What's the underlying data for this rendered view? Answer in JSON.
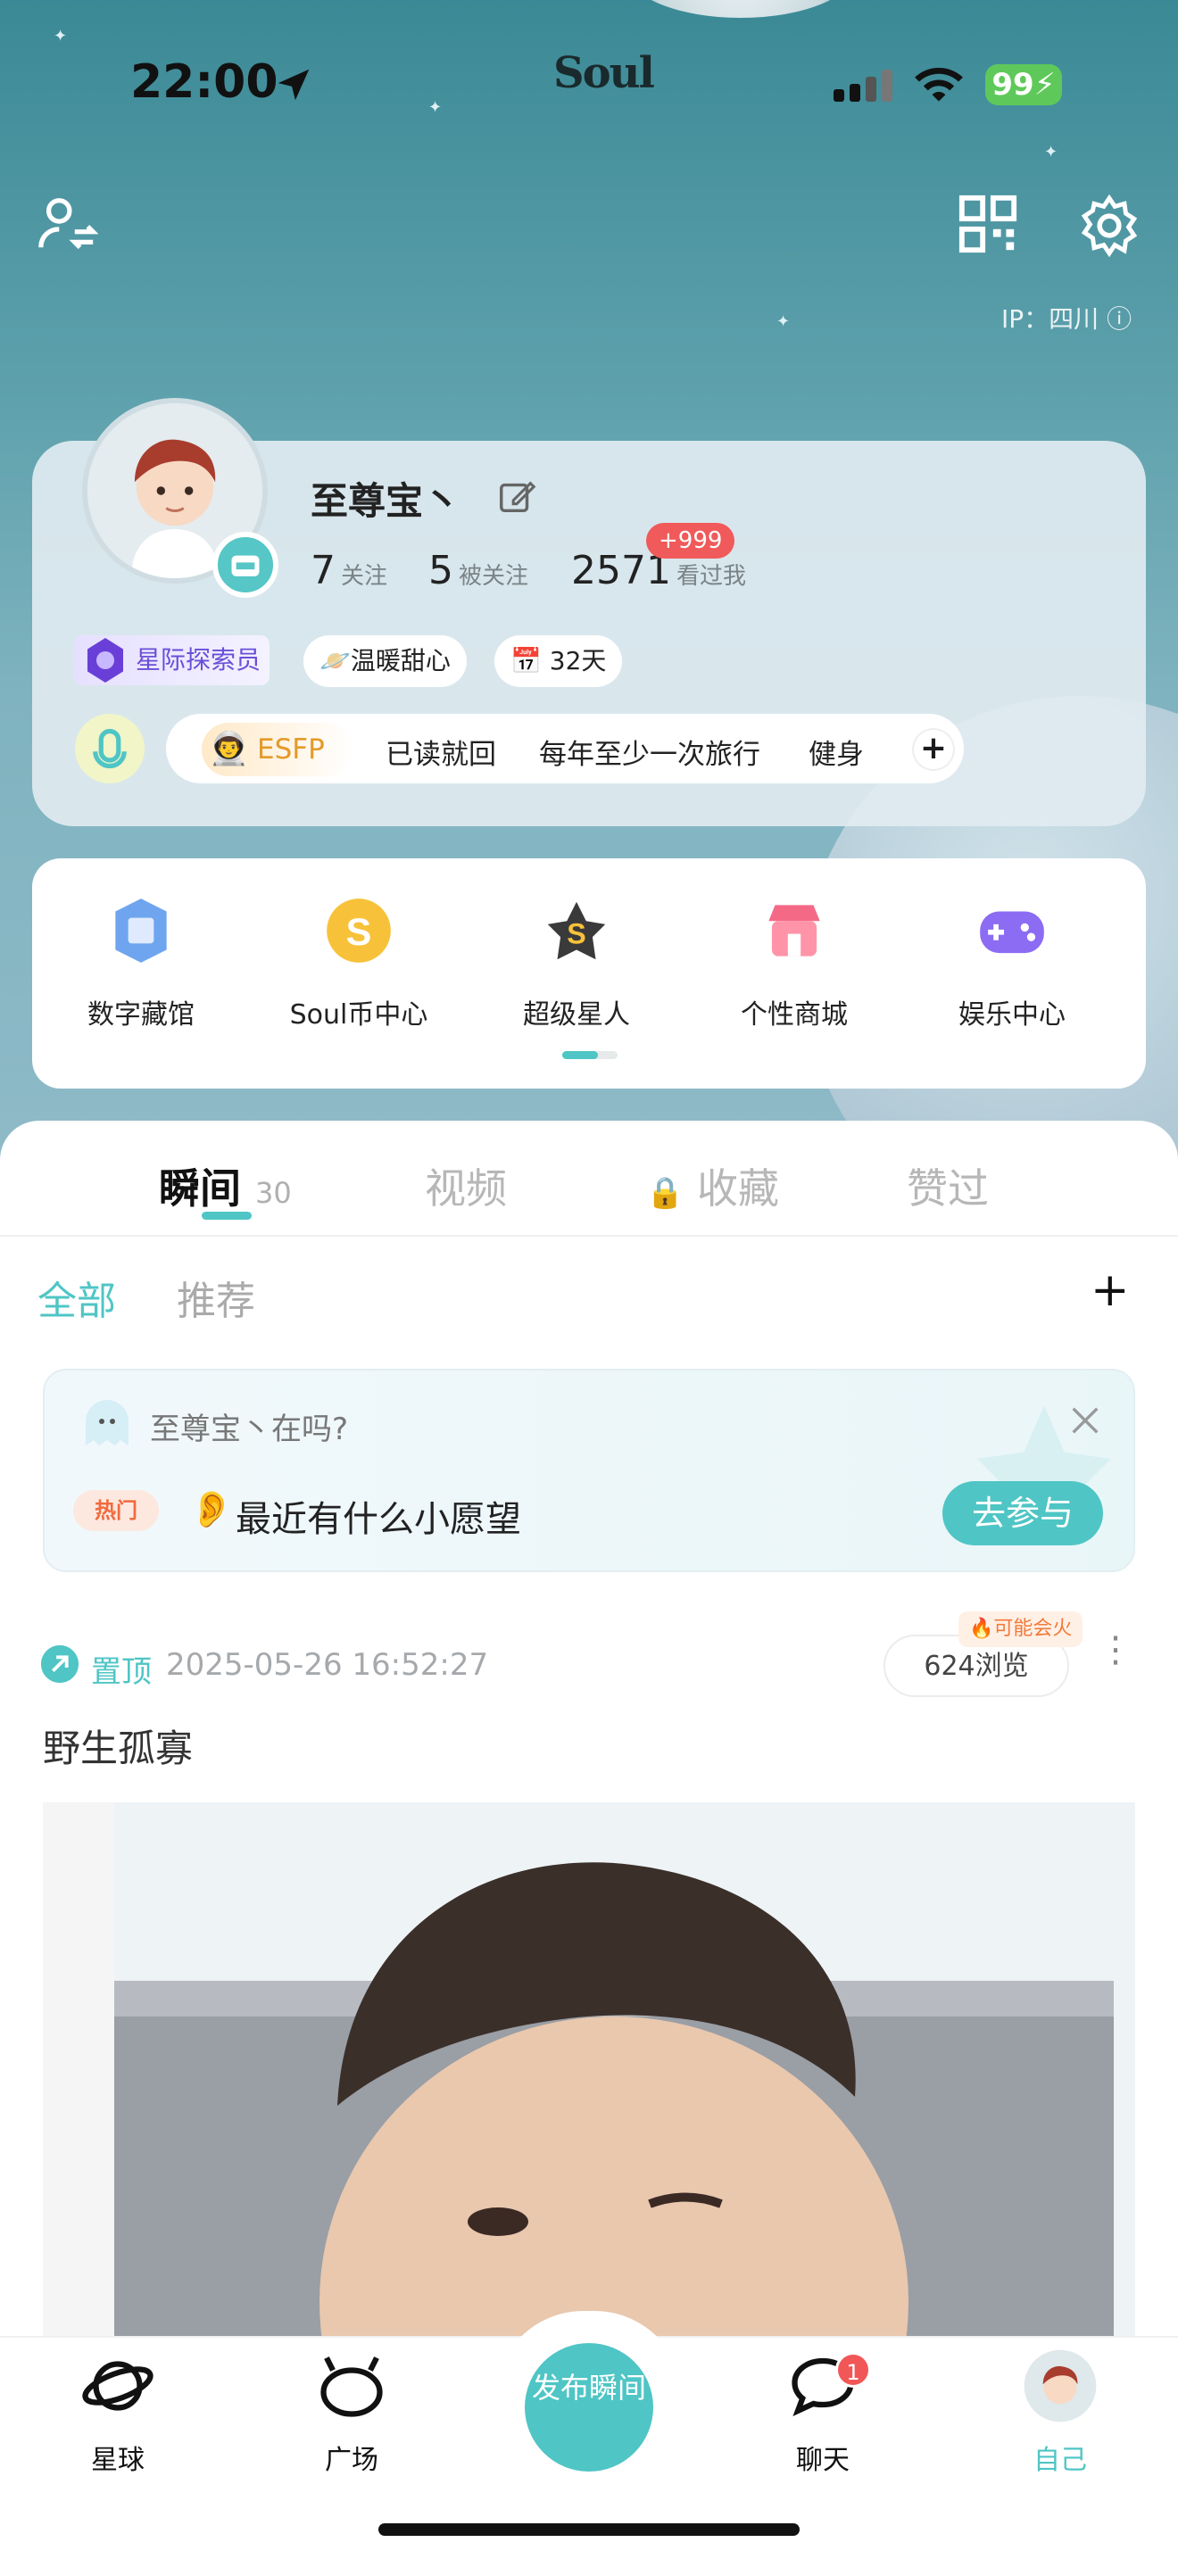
{
  "status_bar": {
    "time": "22:00",
    "app_brand": "Soul",
    "battery": "99"
  },
  "header": {
    "ip_label": "IP：四川"
  },
  "profile": {
    "name": "至尊宝丶",
    "following_count": "7",
    "following_label": "关注",
    "followers_count": "5",
    "followers_label": "被关注",
    "visitors_count": "2571",
    "visitors_label": "看过我",
    "visitors_badge": "+999",
    "explorer_label": "星际探索员",
    "trait_label": "温暖甜心",
    "days_label": "32天",
    "mbti": "ESFP",
    "tags": [
      "已读就回",
      "每年至少一次旅行",
      "健身"
    ]
  },
  "features": [
    {
      "label": "数字藏馆",
      "icon": "digital-museum-icon"
    },
    {
      "label": "Soul币中心",
      "icon": "soul-coin-icon"
    },
    {
      "label": "超级星人",
      "icon": "super-star-icon"
    },
    {
      "label": "个性商城",
      "icon": "shop-icon"
    },
    {
      "label": "娱乐中心",
      "icon": "gamepad-icon"
    }
  ],
  "tabs": [
    {
      "label": "瞬间",
      "count": "30"
    },
    {
      "label": "视频"
    },
    {
      "label": "收藏"
    },
    {
      "label": "赞过"
    }
  ],
  "filters": {
    "all": "全部",
    "recommend": "推荐"
  },
  "promo": {
    "greeting": "至尊宝丶在吗?",
    "hot_label": "热门",
    "topic": "最近有什么小愿望",
    "button": "去参与"
  },
  "post": {
    "pinned_label": "置顶",
    "timestamp": "2025-05-26 16:52:27",
    "views": "624浏览",
    "fire_label": "可能会火",
    "text": "野生孤寡"
  },
  "bottom_nav": {
    "planet": "星球",
    "square": "广场",
    "publish": "发布瞬间",
    "chat": "聊天",
    "chat_badge": "1",
    "me": "自己"
  },
  "colors": {
    "accent": "#4fc5c5",
    "badge_red": "#f05a5a",
    "explorer_purple": "#6a4fd8"
  }
}
